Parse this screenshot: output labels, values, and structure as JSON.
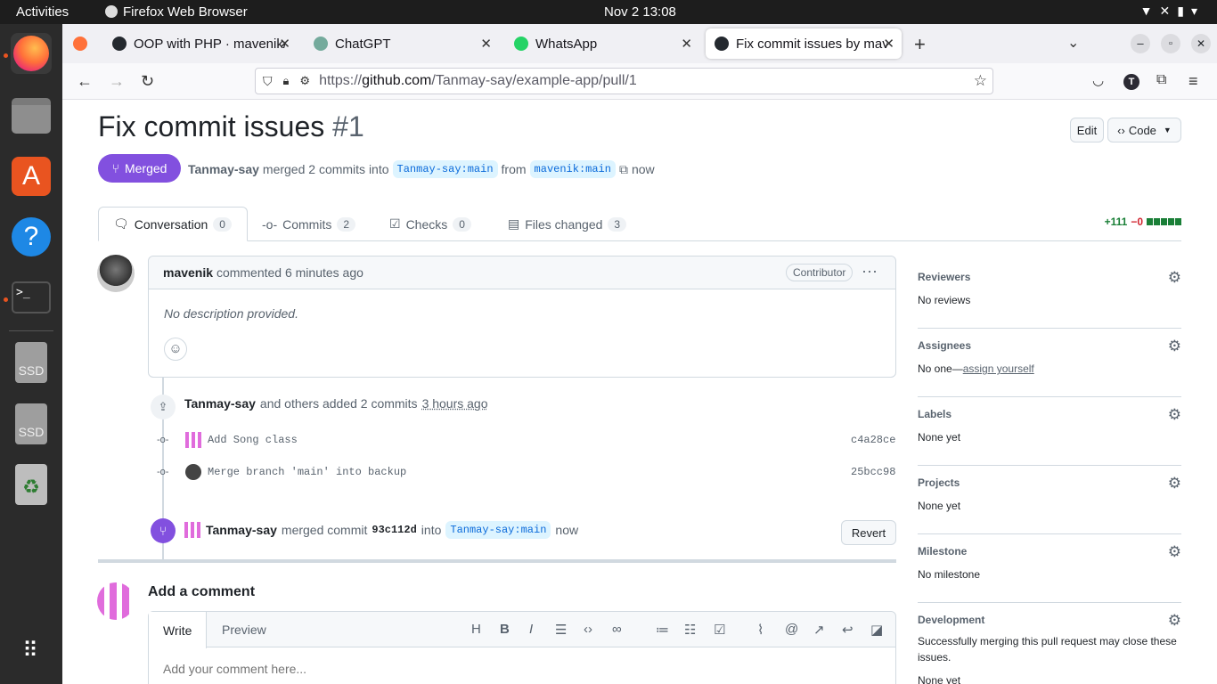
{
  "system": {
    "activities": "Activities",
    "app_name": "Firefox Web Browser",
    "clock": "Nov 2  13:08"
  },
  "browser": {
    "tabs": [
      {
        "label": "OOP with PHP · mavenik/",
        "active": false
      },
      {
        "label": "ChatGPT",
        "active": false
      },
      {
        "label": "WhatsApp",
        "active": false
      },
      {
        "label": "Fix commit issues by mav",
        "active": true
      }
    ],
    "url": "https://github.com/Tanmay-say/example-app/pull/1",
    "url_host": "github.com",
    "url_path": "/Tanmay-say/example-app/pull/1",
    "url_scheme": "https://",
    "profile_initial": "T"
  },
  "pr": {
    "title": "Fix commit issues",
    "number": "#1",
    "edit_label": "Edit",
    "code_label": "Code",
    "status": "Merged",
    "author": "Tanmay-say",
    "merge_text": "merged 2 commits into",
    "base_branch": "Tanmay-say:main",
    "from_text": "from",
    "head_branch": "mavenik:main",
    "time": "now"
  },
  "tabs": [
    {
      "label": "Conversation",
      "count": "0"
    },
    {
      "label": "Commits",
      "count": "2"
    },
    {
      "label": "Checks",
      "count": "0"
    },
    {
      "label": "Files changed",
      "count": "3"
    }
  ],
  "diffstat": {
    "added": "+111",
    "removed": "−0"
  },
  "comment": {
    "author": "mavenik",
    "action": "commented 6 minutes ago",
    "role": "Contributor",
    "body": "No description provided."
  },
  "commits_event": {
    "author": "Tanmay-say",
    "text": "and others added 2 commits",
    "time": "3 hours ago",
    "commits": [
      {
        "message": "Add Song class",
        "sha": "c4a28ce"
      },
      {
        "message": "Merge branch 'main' into backup",
        "sha": "25bcc98"
      }
    ]
  },
  "merge_event": {
    "author": "Tanmay-say",
    "text": "merged commit",
    "sha": "93c112d",
    "into": "into",
    "branch": "Tanmay-say:main",
    "time": "now",
    "revert_label": "Revert"
  },
  "add_comment": {
    "heading": "Add a comment",
    "write_tab": "Write",
    "preview_tab": "Preview",
    "placeholder": "Add your comment here..."
  },
  "sidebar": {
    "reviewers": {
      "title": "Reviewers",
      "value": "No reviews"
    },
    "assignees": {
      "title": "Assignees",
      "value": "No one—",
      "link": "assign yourself"
    },
    "labels": {
      "title": "Labels",
      "value": "None yet"
    },
    "projects": {
      "title": "Projects",
      "value": "None yet"
    },
    "milestone": {
      "title": "Milestone",
      "value": "No milestone"
    },
    "development": {
      "title": "Development",
      "value": "Successfully merging this pull request may close these issues.",
      "value2": "None yet"
    }
  },
  "colors": {
    "merged": "#8250df",
    "link": "#0969da",
    "added": "#1a7f37",
    "removed": "#d1242f"
  }
}
